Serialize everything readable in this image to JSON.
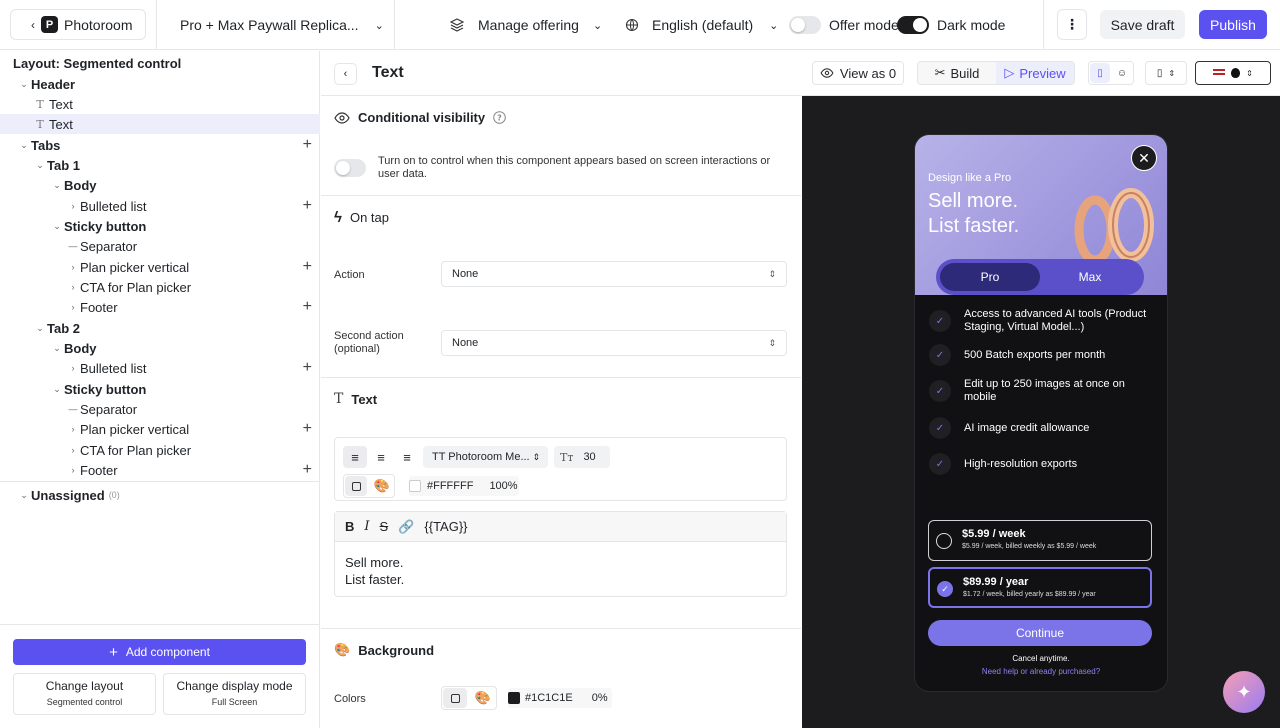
{
  "topbar": {
    "back_label": "Photoroom",
    "logo_letter": "P",
    "project_name": "Pro + Max Paywall Replica...",
    "manage_offering": "Manage offering",
    "language": "English (default)",
    "offer_mode": "Offer mode",
    "dark_mode": "Dark mode",
    "save_draft": "Save draft",
    "publish": "Publish"
  },
  "left": {
    "layout_title": "Layout: Segmented control",
    "tree": {
      "header": "Header",
      "text1": "Text",
      "text2": "Text",
      "tabs": "Tabs",
      "tab1": "Tab 1",
      "body1": "Body",
      "bulleted1": "Bulleted list",
      "sticky1": "Sticky button",
      "separator1": "Separator",
      "planpicker1": "Plan picker vertical",
      "cta1": "CTA for Plan picker",
      "footer1": "Footer",
      "tab2": "Tab 2",
      "body2": "Body",
      "bulleted2": "Bulleted list",
      "sticky2": "Sticky button",
      "separator2": "Separator",
      "planpicker2": "Plan picker vertical",
      "cta2": "CTA for Plan picker",
      "footer2": "Footer",
      "unassigned": "Unassigned",
      "unassigned_count": "(0)"
    },
    "add_component": "Add component",
    "change_layout": "Change layout",
    "change_layout_value": "Segmented control",
    "change_display": "Change display mode",
    "change_display_value": "Full Screen"
  },
  "mid": {
    "title": "Text",
    "conditional_visibility": "Conditional visibility",
    "cv_help": "Turn on to control when this component appears based on screen interactions or user data.",
    "on_tap": "On tap",
    "action_label": "Action",
    "action_value": "None",
    "second_action_label": "Second action (optional)",
    "second_action_value": "None",
    "text_section": "Text",
    "font_name": "TT Photoroom Me...",
    "font_size": "30",
    "color_hex": "#FFFFFF",
    "color_opacity": "100%",
    "tag_label": "{{TAG}}",
    "content_line1": "Sell more.",
    "content_line2": "List faster.",
    "background": "Background",
    "colors_label": "Colors",
    "bg_hex": "#1C1C1E",
    "bg_opacity": "0%"
  },
  "right": {
    "view_as": "View as 0",
    "build": "Build",
    "preview": "Preview"
  },
  "phone": {
    "hero_sub": "Design like a Pro",
    "hero_title_1": "Sell more.",
    "hero_title_2": "List faster.",
    "tab_pro": "Pro",
    "tab_max": "Max",
    "features": [
      "Access to advanced AI tools (Product Staging, Virtual Model...)",
      "500 Batch exports per month",
      "Edit up to 250 images at once on mobile",
      "AI image credit allowance",
      "High-resolution exports"
    ],
    "plan1_price": "$5.99 / week",
    "plan1_desc": "$5.99 / week, billed weekly as $5.99 / week",
    "plan2_price": "$89.99 / year",
    "plan2_desc": "$1.72 / week, billed yearly as $89.99 / year",
    "continue": "Continue",
    "cancel": "Cancel anytime.",
    "help": "Need help or already purchased?"
  },
  "colors": {
    "accent": "#5b50f0",
    "preview_bg": "#1c1c1e",
    "plan_accent": "#7b74e8"
  }
}
